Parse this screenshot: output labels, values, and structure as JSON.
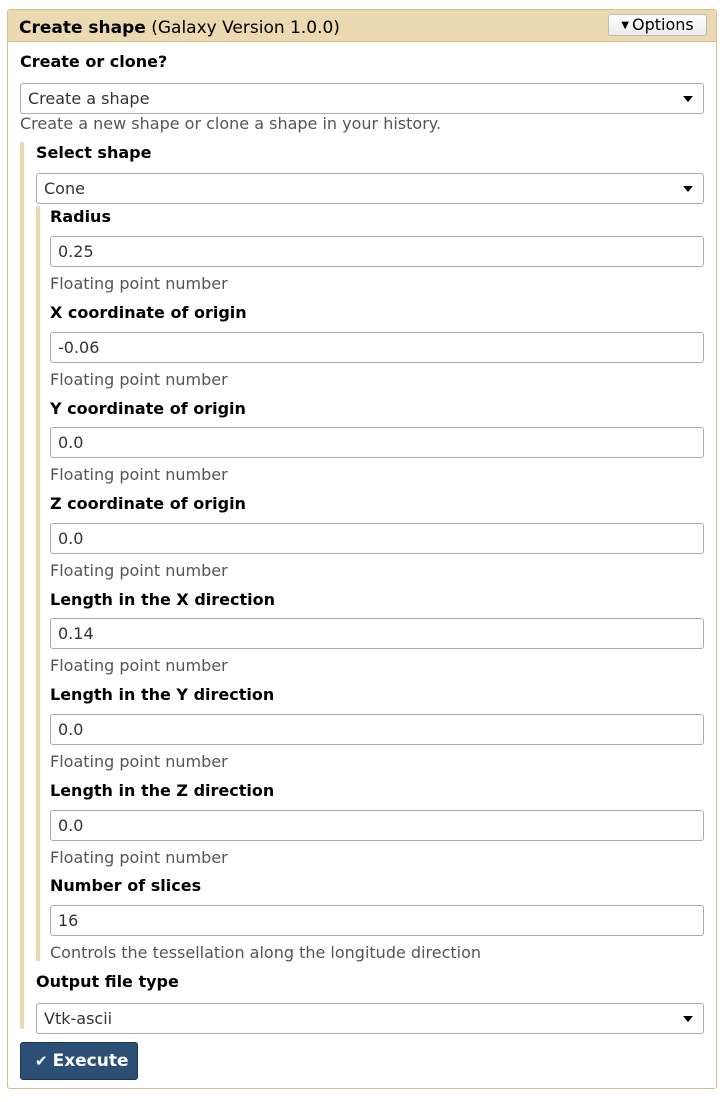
{
  "header": {
    "tool_name": "Create shape",
    "version": "(Galaxy Version 1.0.0)",
    "options_label": "Options"
  },
  "create_or_clone": {
    "label": "Create or clone?",
    "value": "Create a shape",
    "help": "Create a new shape or clone a shape in your history."
  },
  "select_shape": {
    "label": "Select shape",
    "value": "Cone"
  },
  "fields": [
    {
      "label": "Radius",
      "value": "0.25",
      "help": "Floating point number"
    },
    {
      "label": "X coordinate of origin",
      "value": "-0.06",
      "help": "Floating point number"
    },
    {
      "label": "Y coordinate of origin",
      "value": "0.0",
      "help": "Floating point number"
    },
    {
      "label": "Z coordinate of origin",
      "value": "0.0",
      "help": "Floating point number"
    },
    {
      "label": "Length in the X direction",
      "value": "0.14",
      "help": "Floating point number"
    },
    {
      "label": "Length in the Y direction",
      "value": "0.0",
      "help": "Floating point number"
    },
    {
      "label": "Length in the Z direction",
      "value": "0.0",
      "help": "Floating point number"
    },
    {
      "label": "Number of slices",
      "value": "16",
      "help": "Controls the tessellation along the longitude direction"
    }
  ],
  "output_file_type": {
    "label": "Output file type",
    "value": "Vtk-ascii"
  },
  "execute_label": "Execute",
  "colors": {
    "header_bg": "#ebd9b2",
    "execute_bg": "#2c4f76"
  }
}
